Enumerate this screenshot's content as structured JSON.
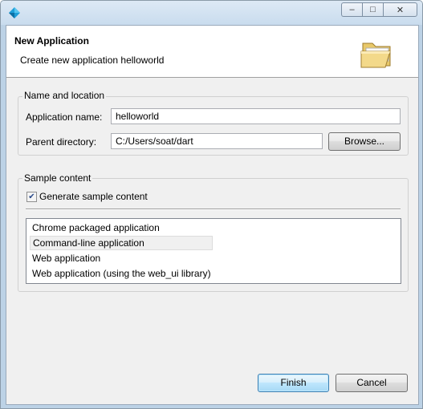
{
  "window": {
    "minimize_label": "–",
    "maximize_label": "□",
    "close_label": "✕"
  },
  "header": {
    "title": "New Application",
    "description": "Create new application helloworld"
  },
  "name_location": {
    "title": "Name and location",
    "app_name_label": "Application name:",
    "app_name_value": "helloworld",
    "parent_dir_label": "Parent directory:",
    "parent_dir_value": "C:/Users/soat/dart",
    "browse_label": "Browse..."
  },
  "sample_content": {
    "title": "Sample content",
    "checkbox_label": "Generate sample content",
    "checkbox_checked": true,
    "items": [
      {
        "label": "Chrome packaged application",
        "selected": false
      },
      {
        "label": "Command-line application",
        "selected": true
      },
      {
        "label": "Web application",
        "selected": false
      },
      {
        "label": "Web application (using the web_ui library)",
        "selected": false
      }
    ]
  },
  "footer": {
    "finish_label": "Finish",
    "cancel_label": "Cancel"
  },
  "colors": {
    "frame": "#bcd2e6",
    "accent": "#3c7fb1",
    "client_bg": "#f0f0f0"
  },
  "icons": {
    "app": "dart-logo-icon",
    "header": "open-folder-icon"
  }
}
